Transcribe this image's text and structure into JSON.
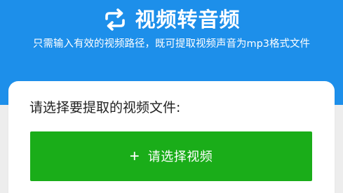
{
  "header": {
    "title": "视频转音频",
    "subtitle": "只需输入有效的视频路径，既可提取视频声音为mp3格式文件",
    "title_icon": "sync-icon",
    "background_color": "#1d8fea"
  },
  "card": {
    "prompt": "请选择要提取的视频文件:",
    "select_button": {
      "icon": "plus-icon",
      "icon_glyph": "+",
      "label": "请选择视频",
      "color": "#1aad19"
    }
  }
}
